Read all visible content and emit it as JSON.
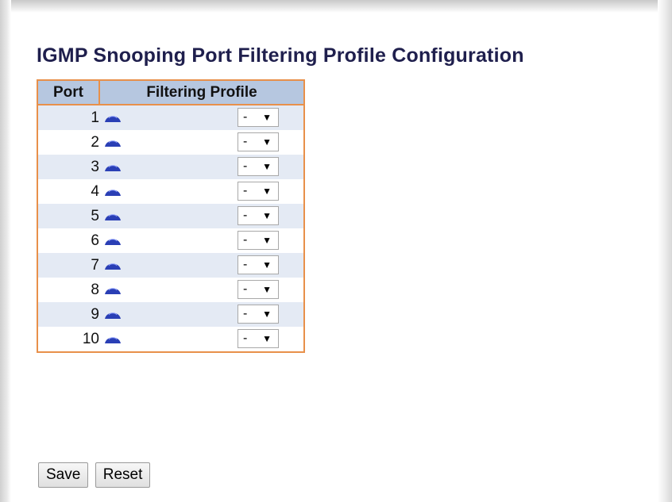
{
  "page": {
    "title": "IGMP Snooping Port Filtering Profile Configuration"
  },
  "table": {
    "headers": {
      "port": "Port",
      "profile": "Filtering Profile"
    },
    "rows": [
      {
        "port": "1",
        "profile": "-"
      },
      {
        "port": "2",
        "profile": "-"
      },
      {
        "port": "3",
        "profile": "-"
      },
      {
        "port": "4",
        "profile": "-"
      },
      {
        "port": "5",
        "profile": "-"
      },
      {
        "port": "6",
        "profile": "-"
      },
      {
        "port": "7",
        "profile": "-"
      },
      {
        "port": "8",
        "profile": "-"
      },
      {
        "port": "9",
        "profile": "-"
      },
      {
        "port": "10",
        "profile": "-"
      }
    ],
    "row_icon": "eye-icon",
    "dropdown_icon": "▼"
  },
  "buttons": {
    "save": "Save",
    "reset": "Reset"
  },
  "colors": {
    "table_border": "#e8904a",
    "header_bg": "#b6c7e0",
    "odd_row_bg": "#e4eaf4",
    "icon": "#2a3fb5",
    "title": "#1f1f4d"
  }
}
